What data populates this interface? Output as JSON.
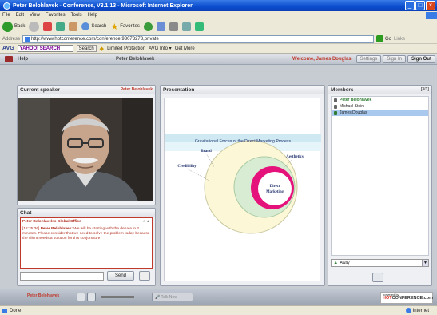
{
  "window": {
    "title": "Peter Belohlavek - Conference, V3.1.13 - Microsoft Internet Explorer"
  },
  "menu": [
    "File",
    "Edit",
    "View",
    "Favorites",
    "Tools",
    "Help"
  ],
  "toolbar": {
    "back": "Back",
    "search": "Search",
    "favorites": "Favorites"
  },
  "address": {
    "label": "Address",
    "url": "http://www.hotconference.com/conference,93073273,private",
    "go": "Go",
    "links": "Links"
  },
  "avgbar": {
    "avg": "AVG",
    "search_placeholder": "YAHOO! SEARCH",
    "search_btn": "Search",
    "limited": "Limited Protection",
    "info": "AVG Info",
    "more": "Get More"
  },
  "appbar": {
    "help": "Help",
    "presenter": "Peter Belohlavek",
    "welcome": "Welcome, James Douglas",
    "settings": "Settings",
    "signin": "Sign In",
    "signout": "Sign Out"
  },
  "speaker": {
    "title": "Current speaker",
    "name": "Peter Belohlavek"
  },
  "chat": {
    "title": "Chat",
    "room": "Peter Belohlavek's Global Office",
    "message_time": "[12:35:36]",
    "message_author": "Peter Belohlavek:",
    "message_text": "We will be starting with the debate in 2 minutes. Please consider that we need to solve the problem today because the client needs a solution for this conjuncture",
    "send": "Send"
  },
  "presentation": {
    "title": "Presentation",
    "slide_title": "Gravitational Forces of the Direct Marketing Process",
    "labels": {
      "brand": "Brand",
      "credibility": "Credibility",
      "aesthetics": "Aesthetics",
      "direct1": "Direct",
      "direct2": "Marketing"
    }
  },
  "members": {
    "title": "Members",
    "count": "[3/3]",
    "list": [
      "Peter Belohlavek",
      "Michael Stein",
      "James Douglas"
    ],
    "status": "Away"
  },
  "bottom": {
    "speaker": "Peter Belohlavek",
    "talk": "Talk Now",
    "powered": "powered by",
    "brand1": "HOT",
    "brand2": "CONFERENCE.com"
  },
  "status": {
    "left": "Done",
    "right": "Internet"
  }
}
